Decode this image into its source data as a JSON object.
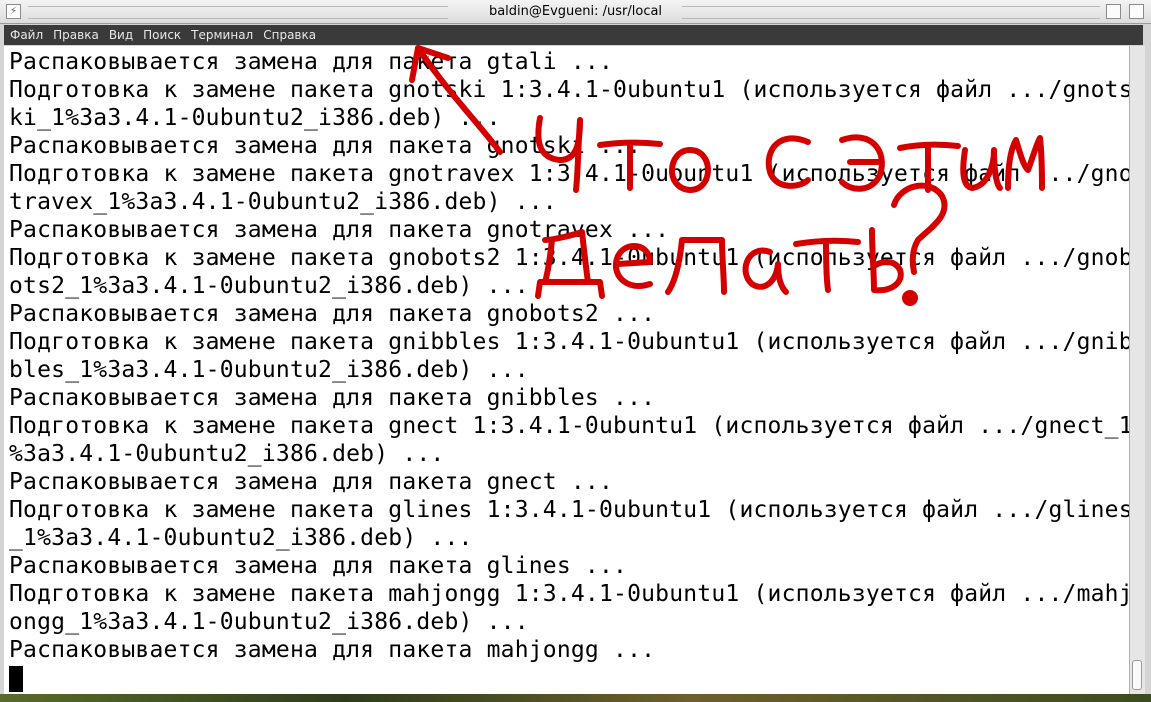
{
  "window": {
    "title": "baldin@Evgueni: /usr/local"
  },
  "menu": [
    {
      "label": "Файл"
    },
    {
      "label": "Правка"
    },
    {
      "label": "Вид"
    },
    {
      "label": "Поиск"
    },
    {
      "label": "Терминал"
    },
    {
      "label": "Справка"
    }
  ],
  "terminal": {
    "lines": [
      "Распаковывается замена для пакета gtali ...",
      "Подготовка к замене пакета gnotski 1:3.4.1-0ubuntu1 (используется файл .../gnots",
      "ki_1%3a3.4.1-0ubuntu2_i386.deb) ...",
      "Распаковывается замена для пакета gnotski ...",
      "Подготовка к замене пакета gnotravex 1:3.4.1-0ubuntu1 (используется файл .../gno",
      "travex_1%3a3.4.1-0ubuntu2_i386.deb) ...",
      "Распаковывается замена для пакета gnotravex ...",
      "Подготовка к замене пакета gnobots2 1:3.4.1-0ubuntu1 (используется файл .../gnob",
      "ots2_1%3a3.4.1-0ubuntu2_i386.deb) ...",
      "Распаковывается замена для пакета gnobots2 ...",
      "Подготовка к замене пакета gnibbles 1:3.4.1-0ubuntu1 (используется файл .../gnib",
      "bles_1%3a3.4.1-0ubuntu2_i386.deb) ...",
      "Распаковывается замена для пакета gnibbles ...",
      "Подготовка к замене пакета gnect 1:3.4.1-0ubuntu1 (используется файл .../gnect_1",
      "%3a3.4.1-0ubuntu2_i386.deb) ...",
      "Распаковывается замена для пакета gnect ...",
      "Подготовка к замене пакета glines 1:3.4.1-0ubuntu1 (используется файл .../glines",
      "_1%3a3.4.1-0ubuntu2_i386.deb) ...",
      "Распаковывается замена для пакета glines ...",
      "Подготовка к замене пакета mahjongg 1:3.4.1-0ubuntu1 (используется файл .../mahj",
      "ongg_1%3a3.4.1-0ubuntu2_i386.deb) ...",
      "Распаковывается замена для пакета mahjongg ..."
    ]
  },
  "annotation": {
    "line1": "Что с этим",
    "line2": "делать?",
    "color": "#d40000"
  }
}
